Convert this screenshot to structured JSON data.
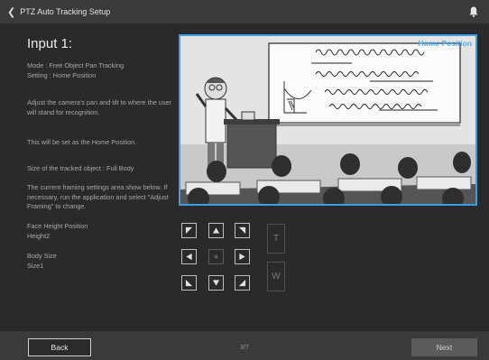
{
  "topbar": {
    "title": "PTZ Auto Tracking Setup",
    "back_icon": "chevron-left-icon",
    "bell_icon": "bell-icon"
  },
  "main": {
    "input_title": "Input 1:",
    "mode_line1": "Mode : Free Object Pan Tracking",
    "mode_line2": "Setting : Home Position",
    "instruction": "Adjust the camera's pan and tilt to where the user will stand for recognition.",
    "home_note": "This will be set as the Home Position.",
    "object_size": "Size of the tracked object : Full Body",
    "framing_note": "The current framing settings area show below. If necessary, run the application and select \"Adjust Framing\" to change.",
    "face_height_label": "Face Height Position",
    "face_height_value": "Height2",
    "body_size_label": "Body Size",
    "body_size_value": "Size1",
    "preview_label": "Home Position",
    "zoom_tele": "T",
    "zoom_wide": "W"
  },
  "footer": {
    "back_label": "Back",
    "page": "3/7",
    "next_label": "Next"
  },
  "colors": {
    "accent": "#3aa0e6",
    "background": "#2a2a2a",
    "bar": "#3a3a3a"
  }
}
